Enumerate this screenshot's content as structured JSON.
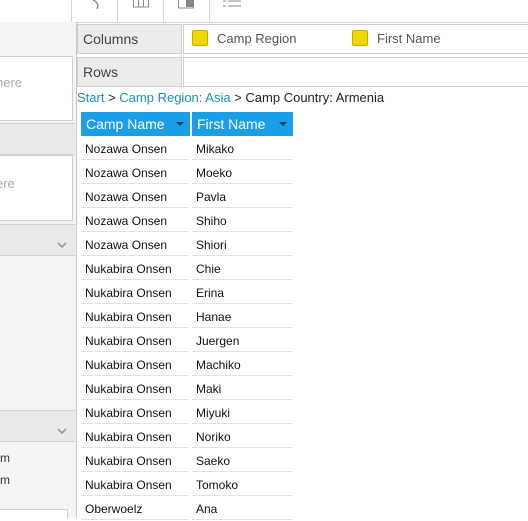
{
  "shelves": {
    "columns_label": "Columns",
    "rows_label": "Rows",
    "columns_fields": [
      "Camp Region",
      "First Name"
    ]
  },
  "left_panel": {
    "drop_placeholder_1": "here",
    "drop_placeholder_2": "ere",
    "list_items": [
      "m",
      "m"
    ]
  },
  "breadcrumb": {
    "start": "Start",
    "sep1": " > ",
    "region": "Camp Region: Asia",
    "sep2": " > ",
    "country": "Camp Country: Armenia"
  },
  "table": {
    "headers": [
      "Camp Name",
      "First Name"
    ],
    "rows": [
      [
        "Nozawa Onsen",
        "Mikako"
      ],
      [
        "Nozawa Onsen",
        "Moeko"
      ],
      [
        "Nozawa Onsen",
        "Pavla"
      ],
      [
        "Nozawa Onsen",
        "Shiho"
      ],
      [
        "Nozawa Onsen",
        "Shiori"
      ],
      [
        "Nukabira Onsen",
        "Chie"
      ],
      [
        "Nukabira Onsen",
        "Erina"
      ],
      [
        "Nukabira Onsen",
        "Hanae"
      ],
      [
        "Nukabira Onsen",
        "Juergen"
      ],
      [
        "Nukabira Onsen",
        "Machiko"
      ],
      [
        "Nukabira Onsen",
        "Maki"
      ],
      [
        "Nukabira Onsen",
        "Miyuki"
      ],
      [
        "Nukabira Onsen",
        "Noriko"
      ],
      [
        "Nukabira Onsen",
        "Saeko"
      ],
      [
        "Nukabira Onsen",
        "Tomoko"
      ],
      [
        "Oberwoelz",
        "Ana"
      ]
    ]
  },
  "colors": {
    "header_bg": "#1a9ee8",
    "link": "#1a8fc9",
    "chip": "#f2d600"
  }
}
